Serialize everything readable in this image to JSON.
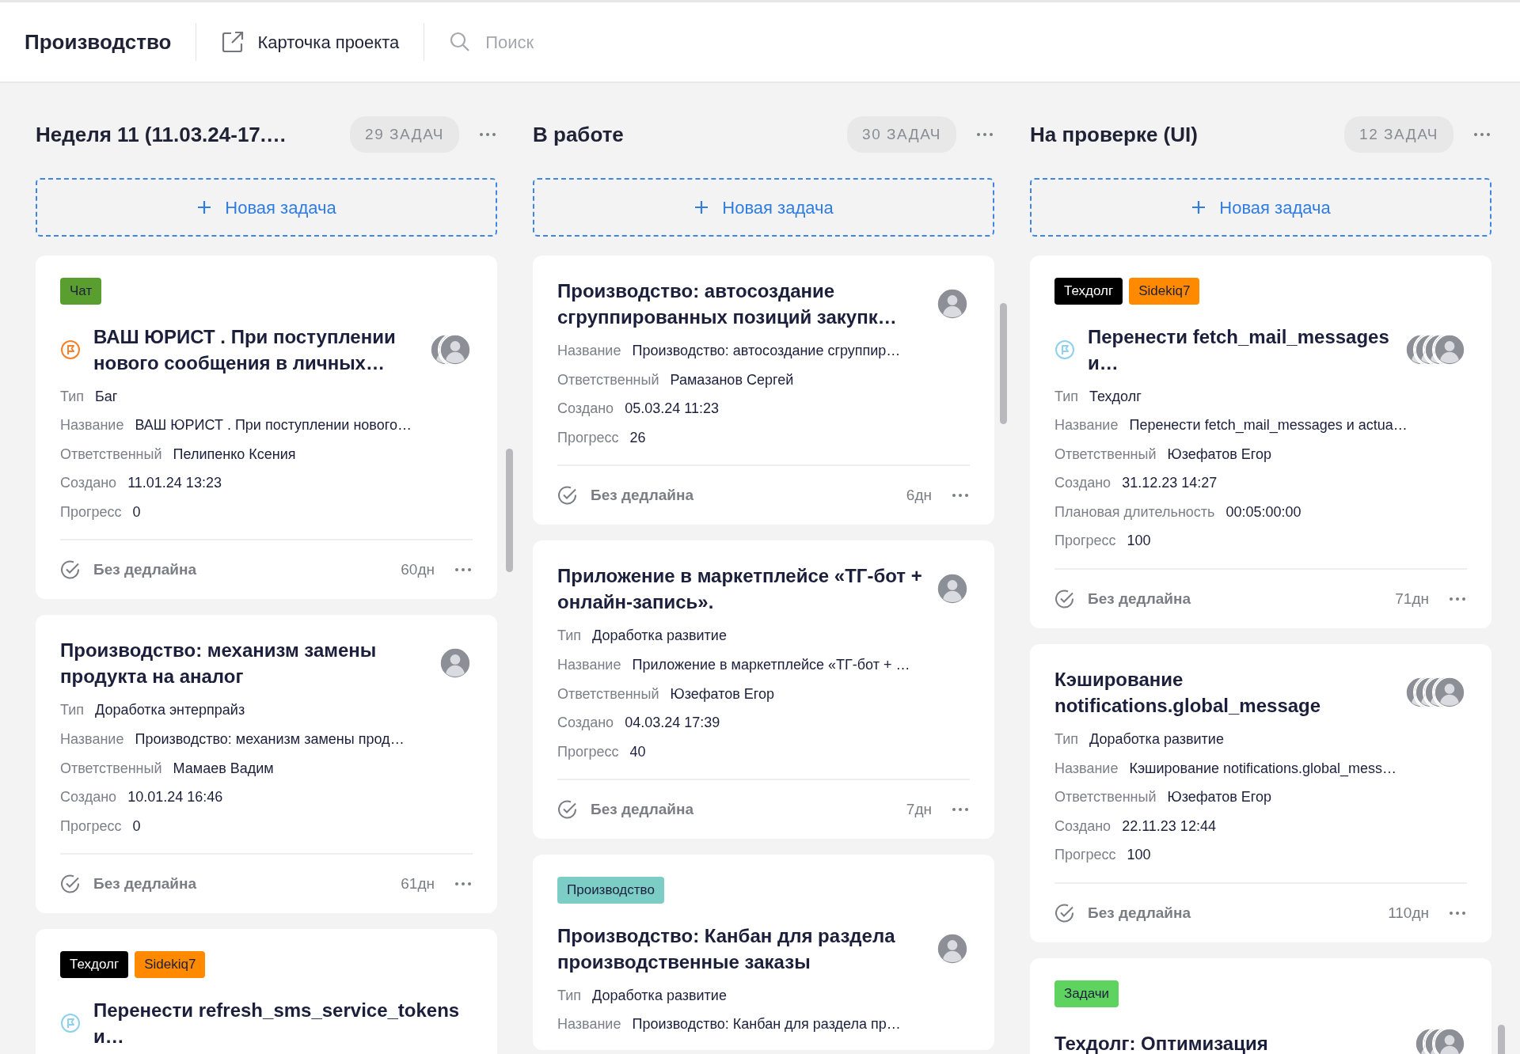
{
  "header": {
    "title": "Производство",
    "project_link": "Карточка проекта",
    "search": {
      "placeholder": "Поиск"
    }
  },
  "columns": [
    {
      "title": "Неделя 11 (11.03.24-17.…",
      "count": "29 ЗАДАЧ",
      "new_task": "Новая задача",
      "cards": [
        {
          "tags": [
            {
              "label": "Чат",
              "color": "#5a9e2f"
            }
          ],
          "flag": {
            "color": "#f5822a"
          },
          "title": "ВАШ ЮРИСТ . При поступлении нового сообщения в личных…",
          "avatars": [
            {
              "kind": "photo"
            },
            {
              "kind": "photo"
            }
          ],
          "fields": [
            {
              "label": "Тип",
              "value": "Баг"
            },
            {
              "label": "Название",
              "value": "ВАШ ЮРИСТ . При поступлении нового…"
            },
            {
              "label": "Ответственный",
              "value": "Пелипенко Ксения"
            },
            {
              "label": "Создано",
              "value": "11.01.24 13:23"
            },
            {
              "label": "Прогресс",
              "value": "0"
            }
          ],
          "footer": {
            "deadline": "Без дедлайна",
            "age": "60дн"
          }
        },
        {
          "title": "Производство: механизм замены продукта на аналог",
          "avatars": [
            {
              "kind": "photo"
            }
          ],
          "fields": [
            {
              "label": "Тип",
              "value": "Доработка энтерпрайз"
            },
            {
              "label": "Название",
              "value": "Производство: механизм замены прод…"
            },
            {
              "label": "Ответственный",
              "value": "Мамаев Вадим"
            },
            {
              "label": "Создано",
              "value": "10.01.24 16:46"
            },
            {
              "label": "Прогресс",
              "value": "0"
            }
          ],
          "footer": {
            "deadline": "Без дедлайна",
            "age": "61дн"
          }
        },
        {
          "tags": [
            {
              "label": "Техдолг",
              "color": "#000000"
            },
            {
              "label": "Sidekiq7",
              "color": "#ff8a00"
            }
          ],
          "flag": {
            "color": "#8fd0ec"
          },
          "title": "Перенести refresh_sms_service_tokens и…"
        }
      ]
    },
    {
      "title": "В работе",
      "count": "30 ЗАДАЧ",
      "new_task": "Новая задача",
      "cards": [
        {
          "title": "Производство: автосоздание сгруппированных позиций закупк…",
          "avatars": [
            {
              "kind": "photo"
            }
          ],
          "fields": [
            {
              "label": "Название",
              "value": "Производство: автосоздание сгруппир…"
            },
            {
              "label": "Ответственный",
              "value": "Рамазанов Сергей"
            },
            {
              "label": "Создано",
              "value": "05.03.24 11:23"
            },
            {
              "label": "Прогресс",
              "value": "26"
            }
          ],
          "footer": {
            "deadline": "Без дедлайна",
            "age": "6дн"
          }
        },
        {
          "title": "Приложение в маркетплейсе «ТГ-бот + онлайн-запись».",
          "avatars": [
            {
              "kind": "photo"
            }
          ],
          "fields": [
            {
              "label": "Тип",
              "value": "Доработка развитие"
            },
            {
              "label": "Название",
              "value": "Приложение в маркетплейсе «ТГ-бот + …"
            },
            {
              "label": "Ответственный",
              "value": "Юзефатов Егор"
            },
            {
              "label": "Создано",
              "value": "04.03.24 17:39"
            },
            {
              "label": "Прогресс",
              "value": "40"
            }
          ],
          "footer": {
            "deadline": "Без дедлайна",
            "age": "7дн"
          }
        },
        {
          "tags": [
            {
              "label": "Производство",
              "color": "#7ccdc6"
            }
          ],
          "title": "Производство: Канбан для раздела производственные заказы",
          "avatars": [
            {
              "kind": "photo"
            }
          ],
          "fields": [
            {
              "label": "Тип",
              "value": "Доработка развитие"
            },
            {
              "label": "Название",
              "value": "Производство: Канбан для раздела пр…"
            }
          ]
        }
      ]
    },
    {
      "title": "На проверке (UI)",
      "count": "12 ЗАДАЧ",
      "new_task": "Новая задача",
      "cards": [
        {
          "tags": [
            {
              "label": "Техдолг",
              "color": "#000000"
            },
            {
              "label": "Sidekiq7",
              "color": "#ff8a00"
            }
          ],
          "flag": {
            "color": "#8fd0ec"
          },
          "title": "Перенести fetch_mail_messages и…",
          "avatars": [
            {
              "kind": "photo"
            },
            {
              "kind": "photo"
            },
            {
              "kind": "photo"
            },
            {
              "kind": "photo"
            }
          ],
          "fields": [
            {
              "label": "Тип",
              "value": "Техдолг"
            },
            {
              "label": "Название",
              "value": "Перенести fetch_mail_messages и actua…"
            },
            {
              "label": "Ответственный",
              "value": "Юзефатов Егор"
            },
            {
              "label": "Создано",
              "value": "31.12.23 14:27"
            },
            {
              "label": "Плановая длительность",
              "value": "00:05:00:00"
            },
            {
              "label": "Прогресс",
              "value": "100"
            }
          ],
          "footer": {
            "deadline": "Без дедлайна",
            "age": "71дн"
          }
        },
        {
          "title": "Кэширование notifications.global_message",
          "avatars": [
            {
              "kind": "photo"
            },
            {
              "kind": "photo"
            },
            {
              "kind": "photo"
            },
            {
              "kind": "photo"
            }
          ],
          "fields": [
            {
              "label": "Тип",
              "value": "Доработка развитие"
            },
            {
              "label": "Название",
              "value": "Кэширование notifications.global_mess…"
            },
            {
              "label": "Ответственный",
              "value": "Юзефатов Егор"
            },
            {
              "label": "Создано",
              "value": "22.11.23 12:44"
            },
            {
              "label": "Прогресс",
              "value": "100"
            }
          ],
          "footer": {
            "deadline": "Без дедлайна",
            "age": "110дн"
          }
        },
        {
          "tags": [
            {
              "label": "Задачи",
              "color": "#5fd35f"
            }
          ],
          "title": "Техдолг: Оптимизация",
          "avatars": [
            {
              "kind": "photo"
            },
            {
              "kind": "photo"
            },
            {
              "kind": "photo"
            }
          ]
        }
      ]
    }
  ]
}
